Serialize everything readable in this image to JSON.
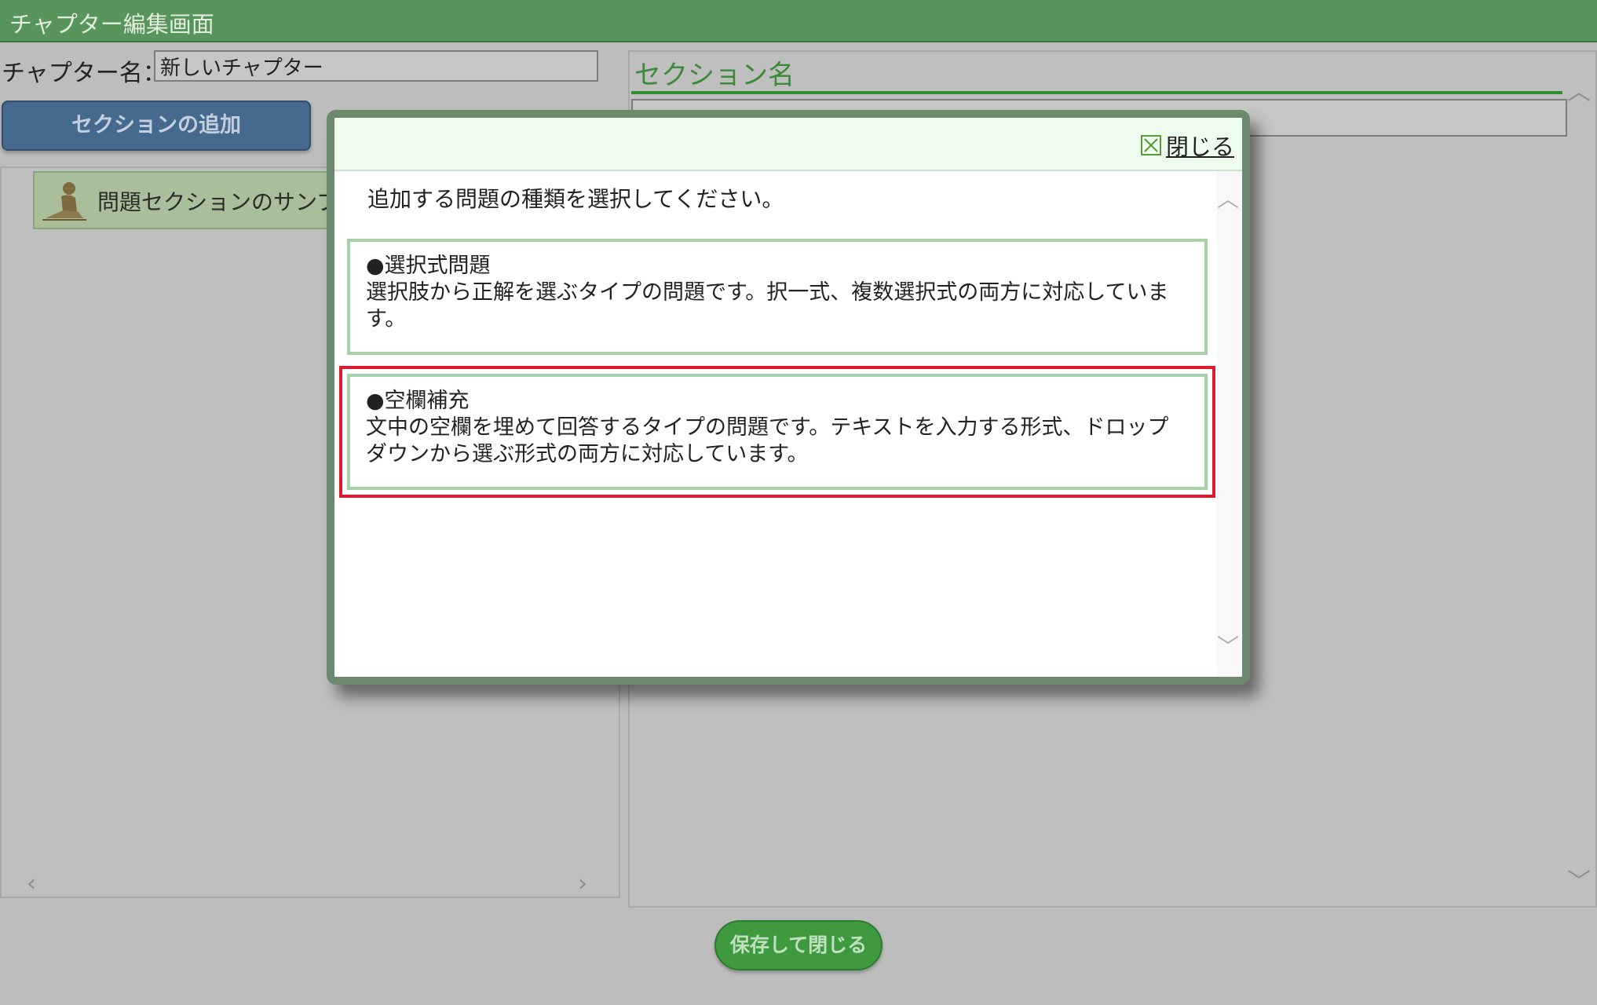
{
  "window": {
    "title": "チャプター編集画面"
  },
  "chapter": {
    "label": "チャプター名：",
    "value": "新しいチャプター"
  },
  "left": {
    "add_section_label": "セクションの追加",
    "sections": [
      {
        "label": "問題セクションのサンプ"
      }
    ]
  },
  "right": {
    "section_name_heading": "セクション名"
  },
  "footer": {
    "save_close_label": "保存して閉じる"
  },
  "modal": {
    "close_label": "閉じる",
    "instruction": "追加する問題の種類を選択してください。",
    "options": [
      {
        "title": "●選択式問題",
        "description": "選択肢から正解を選ぶタイプの問題です。択一式、複数選択式の両方に対応しています。"
      },
      {
        "title": "●空欄補充",
        "description": "文中の空欄を埋めて回答するタイプの問題です。テキストを入力する形式、ドロップダウンから選ぶ形式の両方に対応しています。"
      }
    ]
  },
  "colors": {
    "header_green": "#58955a",
    "accent_green": "#3d8a3d",
    "highlight_red": "#dd1b2e",
    "button_blue": "#46698e"
  }
}
